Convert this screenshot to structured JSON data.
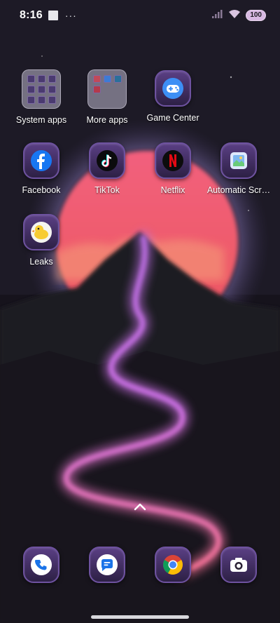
{
  "status_bar": {
    "time": "8:16",
    "battery": "100"
  },
  "apps": [
    {
      "key": "system-apps",
      "label": "System apps",
      "type": "folder"
    },
    {
      "key": "more-apps",
      "label": "More apps",
      "type": "folder"
    },
    {
      "key": "game-center",
      "label": "Game Center",
      "icon": "game-controller-icon"
    },
    {
      "key": "facebook",
      "label": "Facebook",
      "icon": "facebook-icon"
    },
    {
      "key": "tiktok",
      "label": "TikTok",
      "icon": "tiktok-icon"
    },
    {
      "key": "netflix",
      "label": "Netflix",
      "icon": "netflix-icon"
    },
    {
      "key": "automatic-scr",
      "label": "Automatic Scr…",
      "icon": "automatic-screenshot-icon"
    },
    {
      "key": "leaks",
      "label": "Leaks",
      "icon": "duck-icon"
    }
  ],
  "dock": [
    {
      "key": "phone",
      "icon": "phone-icon"
    },
    {
      "key": "messages",
      "icon": "messages-icon"
    },
    {
      "key": "chrome",
      "icon": "chrome-icon"
    },
    {
      "key": "camera",
      "icon": "camera-icon"
    }
  ],
  "colors": {
    "sun": "#f0637e",
    "river": "#d56bd8",
    "tile": "#4a346e"
  }
}
